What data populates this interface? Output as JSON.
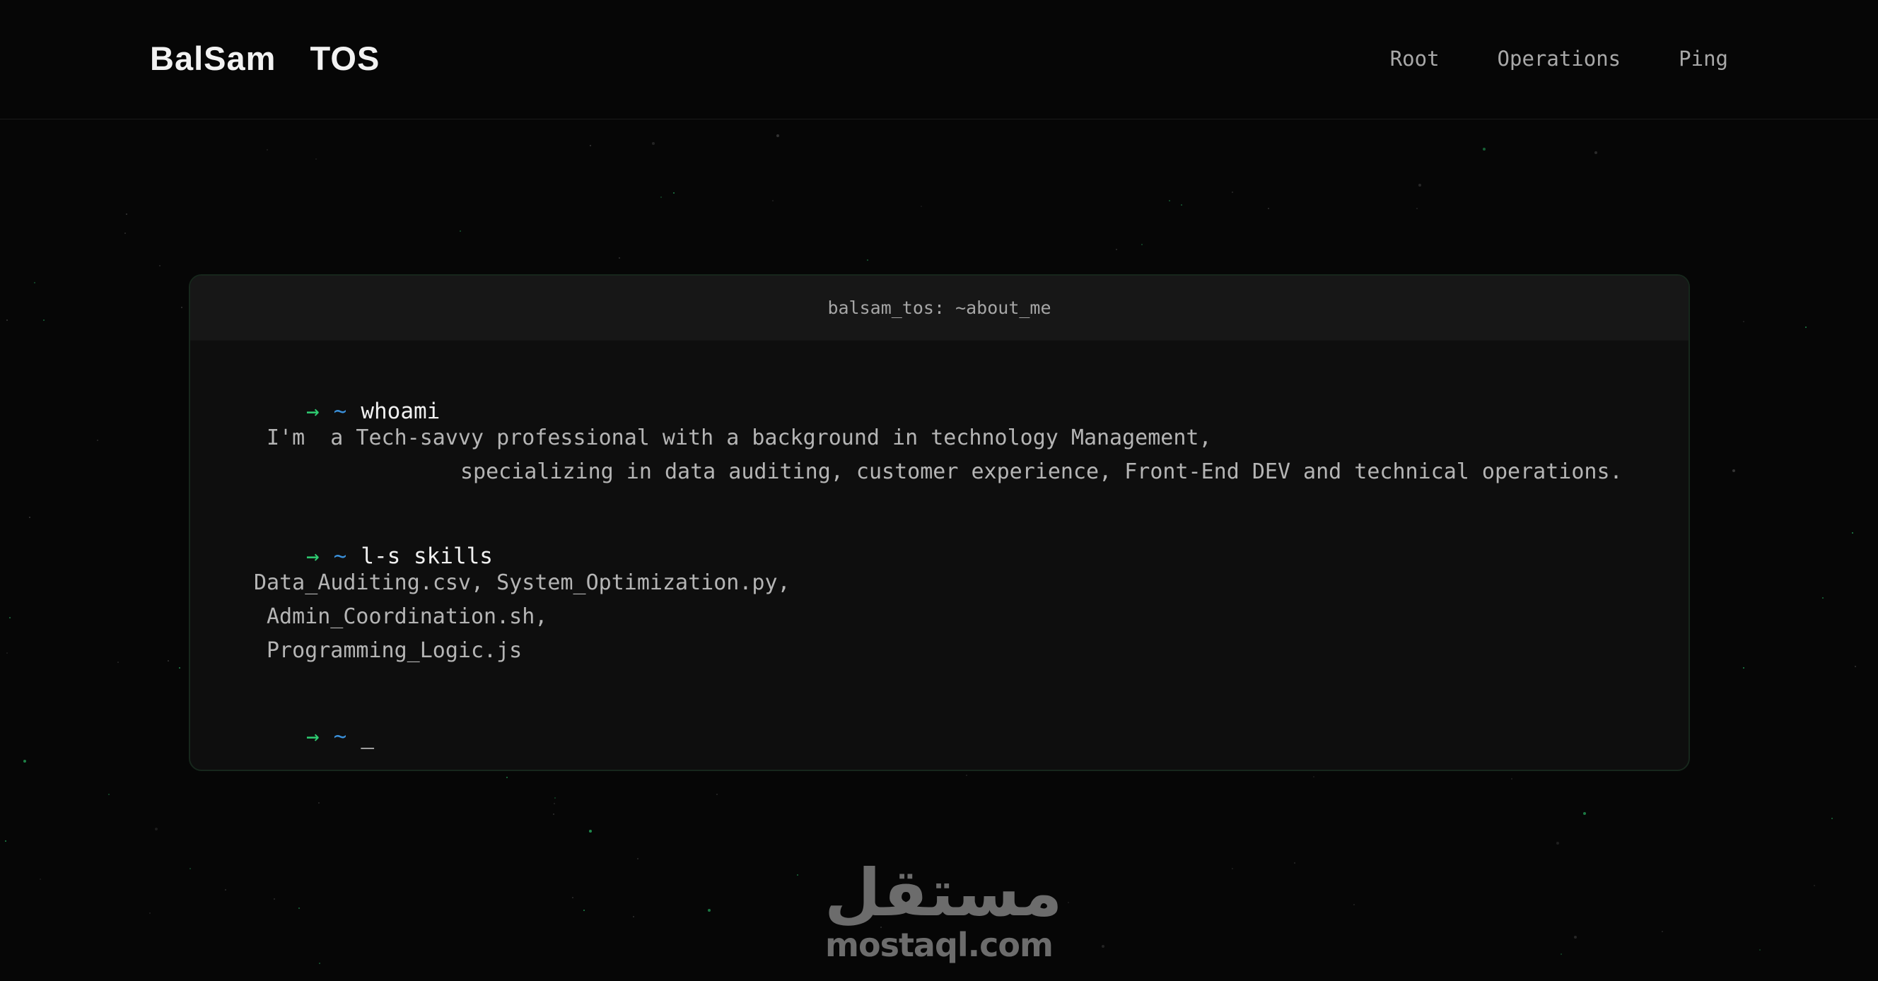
{
  "header": {
    "logo": "BalSam  TOS",
    "nav": [
      {
        "label": "Root"
      },
      {
        "label": "Operations"
      },
      {
        "label": "Ping"
      }
    ]
  },
  "terminal": {
    "title": "balsam_tos: ~about_me",
    "prompt_arrow": "→",
    "prompt_tilde": "~",
    "commands": [
      {
        "command": "whoami",
        "output": [
          "I'm  a Tech-savvy professional with a background in technology Management,",
          "specializing in data auditing, customer experience, Front-End DEV and technical operations."
        ]
      },
      {
        "command": "l-s skills",
        "output": [
          "Data_Auditing.csv, System_Optimization.py,",
          "Admin_Coordination.sh,",
          "Programming_Logic.js"
        ]
      }
    ],
    "cursor": "_"
  },
  "watermark": {
    "arabic": "مستقل",
    "latin": "mostaql.com"
  },
  "colors": {
    "background": "#060606",
    "accent_green": "#2ecc71",
    "accent_blue": "#3a8fd8"
  }
}
